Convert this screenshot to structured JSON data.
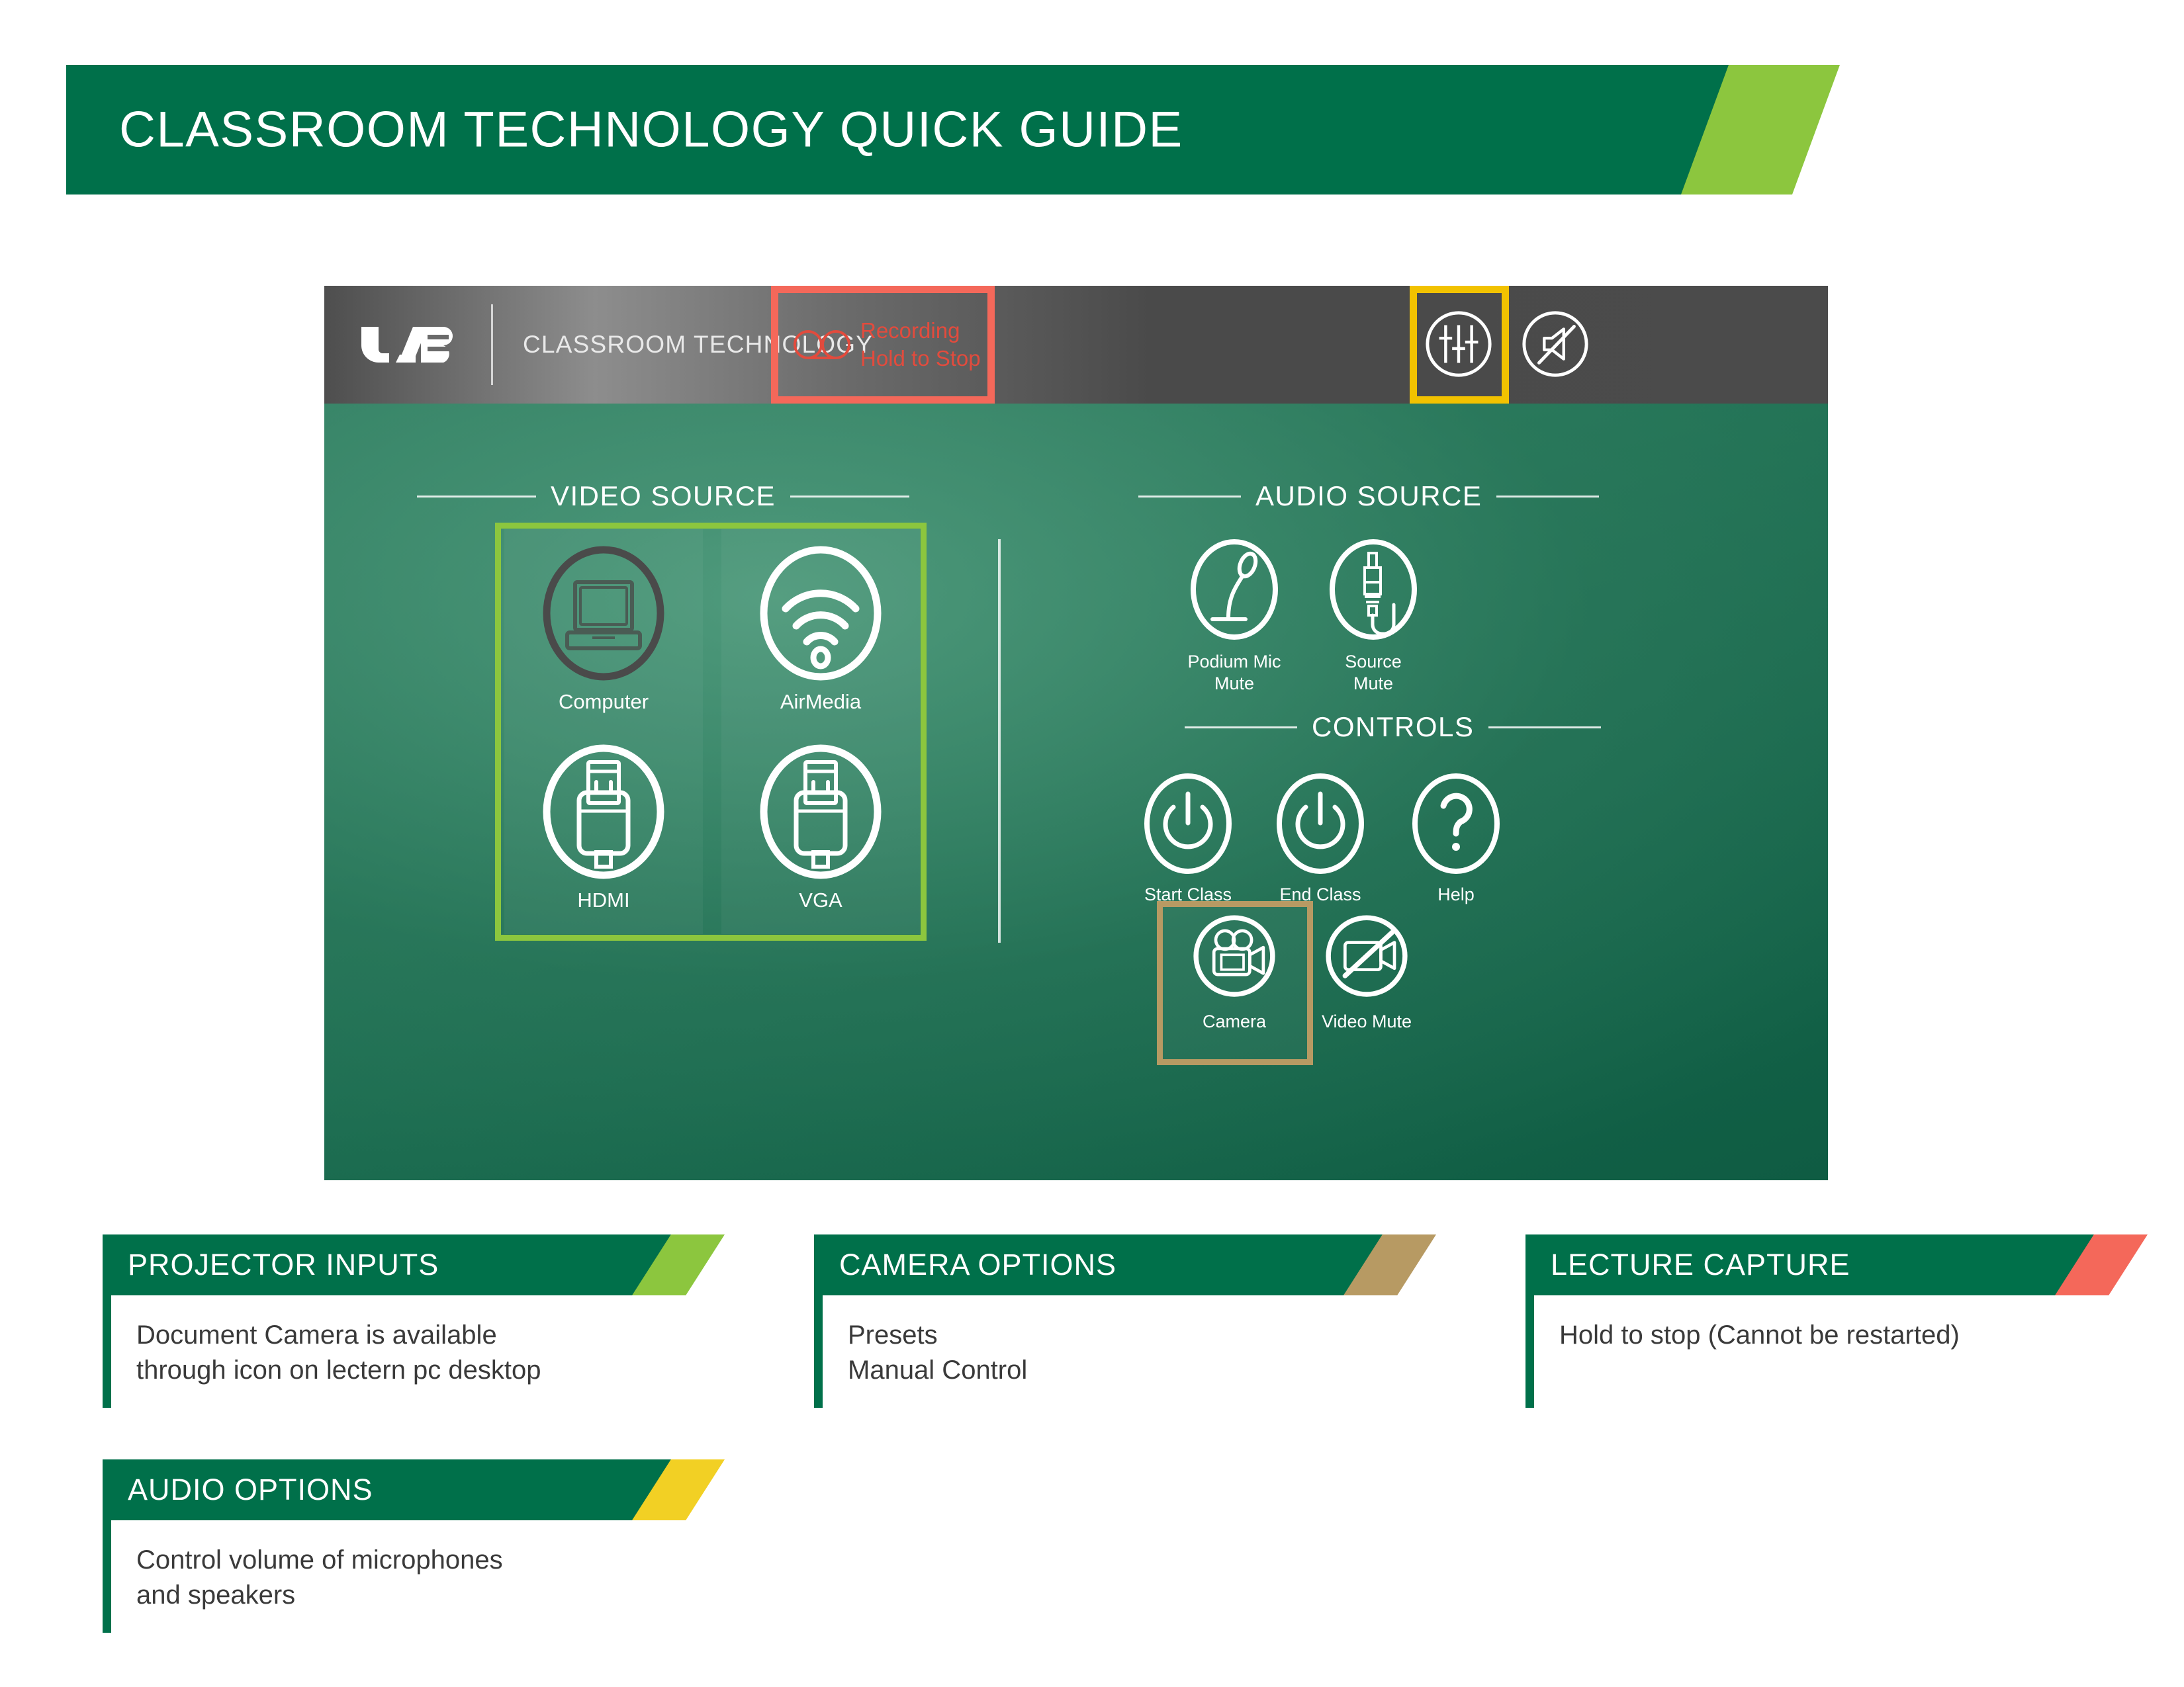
{
  "banner": {
    "title": "CLASSROOM TECHNOLOGY QUICK GUIDE",
    "green": "#00704a",
    "accent": "#8cc63e"
  },
  "panel": {
    "header": {
      "logo_text": "UAB",
      "title": "CLASSROOM TECHNOLOGY",
      "recording": {
        "line1": "Recording",
        "line2": "Hold to Stop",
        "highlight_color": "#f4685a",
        "text_color": "#e24b3d",
        "icon": "tape-reel-icon"
      },
      "mixer": {
        "icon": "audio-mixer-sliders-icon",
        "highlight_color": "#f2c200"
      },
      "speaker_mute": {
        "icon": "speaker-mute-icon"
      }
    },
    "video_source": {
      "header": "VIDEO SOURCE",
      "highlight_color": "#8cc63e",
      "tiles": [
        {
          "label": "Computer",
          "icon": "laptop-icon",
          "state": "dimmed"
        },
        {
          "label": "AirMedia",
          "icon": "wifi-icon",
          "state": "active"
        },
        {
          "label": "HDMI",
          "icon": "hdmi-connector-icon",
          "state": "active"
        },
        {
          "label": "VGA",
          "icon": "vga-connector-icon",
          "state": "active"
        }
      ]
    },
    "audio_source": {
      "header": "AUDIO SOURCE",
      "tiles": [
        {
          "label": "Podium Mic\nMute",
          "line1": "Podium Mic",
          "line2": "Mute",
          "icon": "gooseneck-microphone-icon"
        },
        {
          "label": "Source Mute",
          "line1": "Source",
          "line2": "Mute",
          "icon": "audio-jack-plug-icon"
        }
      ]
    },
    "controls": {
      "header": "CONTROLS",
      "tiles": [
        {
          "label": "Start Class",
          "icon": "power-icon"
        },
        {
          "label": "End Class",
          "icon": "power-icon"
        },
        {
          "label": "Help",
          "icon": "question-mark-icon"
        },
        {
          "label": "Camera",
          "icon": "movie-camera-icon",
          "highlight_color": "#b79a63"
        },
        {
          "label": "Video Mute",
          "icon": "camera-crossed-out-icon"
        }
      ]
    }
  },
  "callouts": [
    {
      "title": "PROJECTOR INPUTS",
      "accent": "#8cc63e",
      "body_line1": "Document Camera is available",
      "body_line2": "through icon on lectern pc desktop"
    },
    {
      "title": "CAMERA OPTIONS",
      "accent": "#b79a63",
      "body_line1": "Presets",
      "body_line2": "Manual Control"
    },
    {
      "title": "LECTURE CAPTURE",
      "accent": "#f4685a",
      "body_line1": "Hold to stop (Cannot be restarted)",
      "body_line2": ""
    },
    {
      "title": "AUDIO OPTIONS",
      "accent": "#f2d024",
      "body_line1": "Control volume of microphones",
      "body_line2": "and speakers"
    }
  ]
}
